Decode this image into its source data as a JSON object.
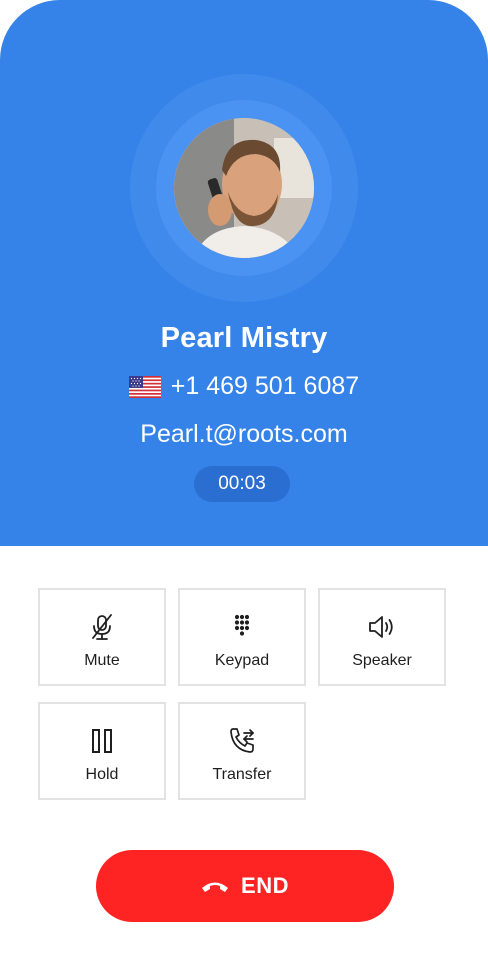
{
  "contact": {
    "name": "Pearl Mistry",
    "phone": "+1 469 501 6087",
    "email": "Pearl.t@roots.com",
    "country_flag_icon": "us-flag-icon"
  },
  "call": {
    "timer": "00:03"
  },
  "actions": {
    "mute": {
      "label": "Mute",
      "icon": "microphone-off-icon"
    },
    "keypad": {
      "label": "Keypad",
      "icon": "dialpad-icon"
    },
    "speaker": {
      "label": "Speaker",
      "icon": "speaker-icon"
    },
    "hold": {
      "label": "Hold",
      "icon": "pause-icon"
    },
    "transfer": {
      "label": "Transfer",
      "icon": "call-transfer-icon"
    }
  },
  "end_call": {
    "label": "END",
    "icon": "hang-up-icon"
  },
  "colors": {
    "header_bg": "#3583e8",
    "timer_bg": "#2a6ed2",
    "end_button": "#ff2424",
    "tile_border": "#e2e2e2"
  }
}
